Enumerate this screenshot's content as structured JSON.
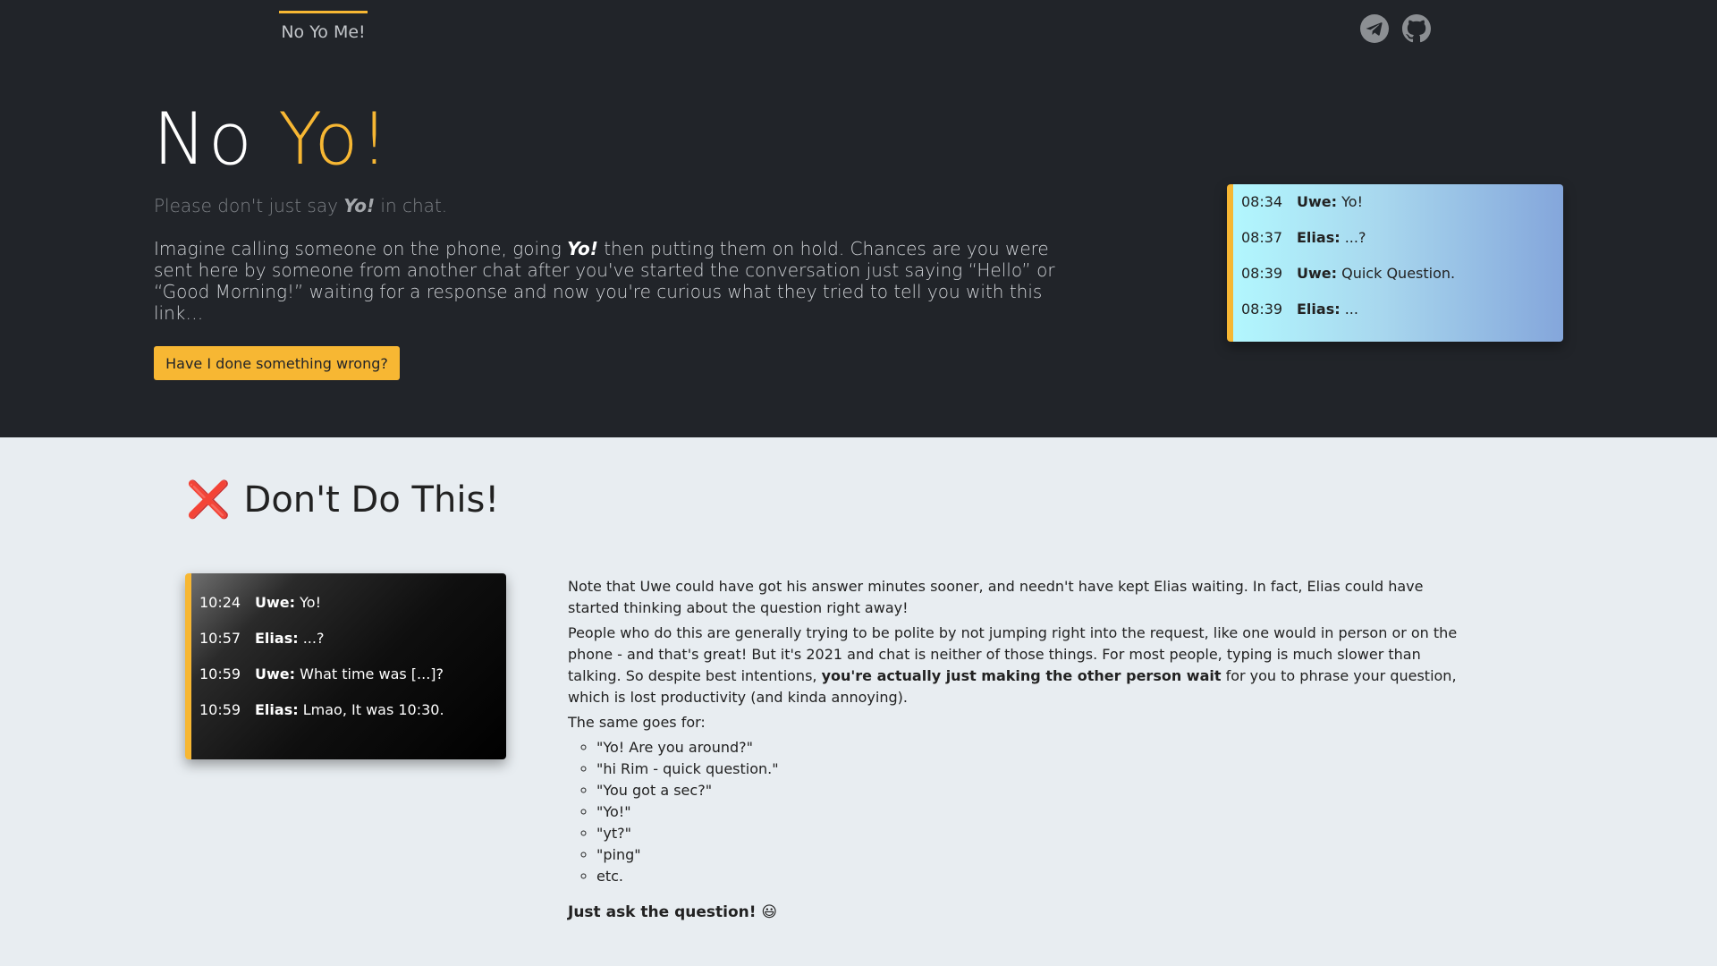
{
  "nav": {
    "link": "No Yo Me!",
    "icons": [
      "telegram-icon",
      "github-icon"
    ]
  },
  "hero": {
    "title_plain": "No ",
    "title_accent": "Yo!",
    "subtitle_before": "Please don't just say ",
    "subtitle_em": "Yo!",
    "subtitle_after": " in chat.",
    "lead_before": "Imagine calling someone on the phone, going ",
    "lead_em": "Yo!",
    "lead_after": " then putting them on hold. Chances are you were sent here by someone from another chat after you've started the conversation just saying “Hello” or “Good Morning!” waiting for a response and now you're curious what they tried to tell you with this link…",
    "button": "Have I done something wrong?"
  },
  "hero_chat": [
    {
      "time": "08:34",
      "name": "Uwe:",
      "text": "Yo!"
    },
    {
      "time": "08:37",
      "name": "Elias:",
      "text": "...?"
    },
    {
      "time": "08:39",
      "name": "Uwe:",
      "text": "Quick Question."
    },
    {
      "time": "08:39",
      "name": "Elias:",
      "text": "..."
    }
  ],
  "section": {
    "title_icon": "❌",
    "title": "Don't Do This!",
    "chat": [
      {
        "time": "10:24",
        "name": "Uwe:",
        "text": "Yo!"
      },
      {
        "time": "10:57",
        "name": "Elias:",
        "text": "...?"
      },
      {
        "time": "10:59",
        "name": "Uwe:",
        "text": "What time was [...]?"
      },
      {
        "time": "10:59",
        "name": "Elias:",
        "text": "Lmao, It was 10:30."
      }
    ],
    "p1": "Note that Uwe could have got his answer minutes sooner, and needn't have kept Elias waiting. In fact, Elias could have started thinking about the question right away!",
    "p2_before": "People who do this are generally trying to be polite by not jumping right into the request, like one would in person or on the phone - and that's great! But it's 2021 and chat is neither of those things. For most people, typing is much slower than talking. So despite best intentions, ",
    "p2_bold": "you're actually just making the other person wait",
    "p2_after": " for you to phrase your question, which is lost productivity (and kinda annoying).",
    "p3": "The same goes for:",
    "list": [
      "\"Yo! Are you around?\"",
      "\"hi Rim - quick question.\"",
      "\"You got a sec?\"",
      "\"Yo!\"",
      "\"yt?\"",
      "\"ping\"",
      "etc."
    ],
    "final": "Just ask the question! 😃"
  },
  "colors": {
    "accent": "#f7b733",
    "hero_bg": "#212429",
    "page_bg": "#e8edf1"
  }
}
